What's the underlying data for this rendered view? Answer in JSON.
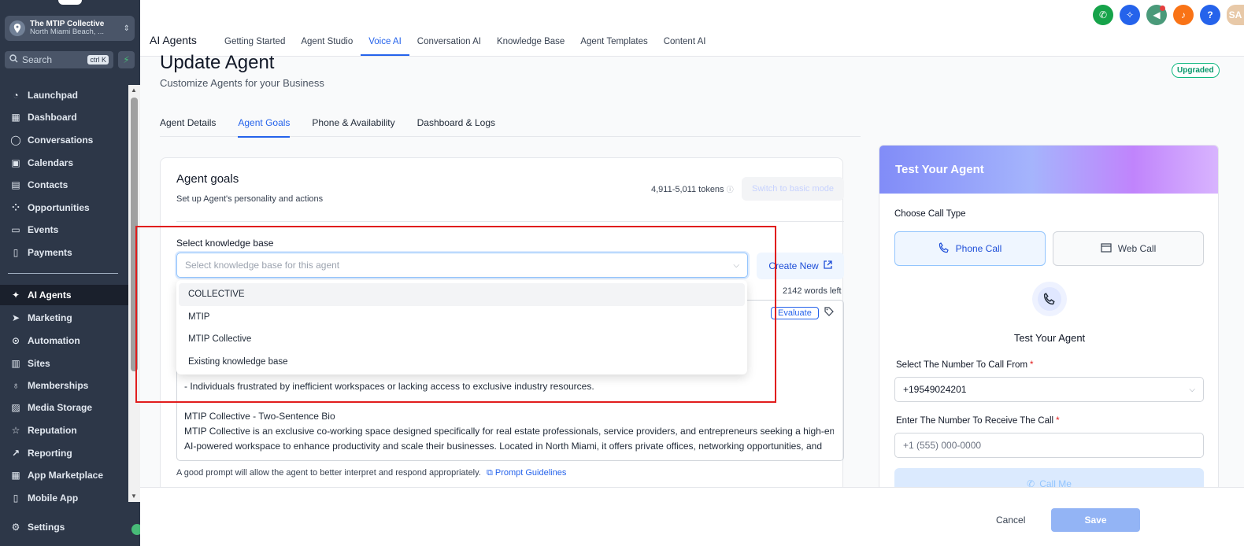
{
  "sidebar": {
    "account_name": "The MTIP Collective",
    "account_location": "North Miami Beach, ...",
    "search_placeholder": "Search",
    "search_shortcut": "ctrl K",
    "items": [
      {
        "label": "Launchpad",
        "icon": "rocket-icon"
      },
      {
        "label": "Dashboard",
        "icon": "grid-icon"
      },
      {
        "label": "Conversations",
        "icon": "chat-icon"
      },
      {
        "label": "Calendars",
        "icon": "calendar-icon"
      },
      {
        "label": "Contacts",
        "icon": "contacts-icon"
      },
      {
        "label": "Opportunities",
        "icon": "funnel-icon"
      },
      {
        "label": "Events",
        "icon": "event-icon"
      },
      {
        "label": "Payments",
        "icon": "receipt-icon"
      },
      {
        "label": "AI Agents",
        "icon": "sparkle-icon"
      },
      {
        "label": "Marketing",
        "icon": "send-icon"
      },
      {
        "label": "Automation",
        "icon": "automation-icon"
      },
      {
        "label": "Sites",
        "icon": "sites-icon"
      },
      {
        "label": "Memberships",
        "icon": "membership-icon"
      },
      {
        "label": "Media Storage",
        "icon": "image-icon"
      },
      {
        "label": "Reputation",
        "icon": "star-icon"
      },
      {
        "label": "Reporting",
        "icon": "trend-icon"
      },
      {
        "label": "App Marketplace",
        "icon": "apps-icon"
      },
      {
        "label": "Mobile App",
        "icon": "mobile-icon"
      }
    ],
    "settings_label": "Settings"
  },
  "topbar": {
    "app_title": "AI Agents",
    "tabs": [
      "Getting Started",
      "Agent Studio",
      "Voice AI",
      "Conversation AI",
      "Knowledge Base",
      "Agent Templates",
      "Content AI"
    ],
    "avatar_initials": "SA",
    "colors": {
      "phone": "#16a34a",
      "magic": "#2563eb",
      "announce": "#4a9a7a",
      "bell": "#f97316",
      "help": "#2563eb",
      "avatar": "#e8c9a8"
    }
  },
  "page": {
    "title": "Update Agent",
    "subtitle": "Customize Agents for your Business",
    "badge": "Upgraded",
    "subtabs": [
      "Agent Details",
      "Agent Goals",
      "Phone & Availability",
      "Dashboard & Logs"
    ]
  },
  "goals": {
    "title": "Agent goals",
    "subtitle": "Set up Agent's personality and actions",
    "tokens": "4,911-5,011 tokens",
    "basic_mode": "Switch to basic mode",
    "kb_label": "Select knowledge base",
    "kb_placeholder": "Select knowledge base for this agent",
    "create_new": "Create New",
    "words_left": "2142 words left",
    "evaluate": "Evaluate",
    "kb_options": [
      "COLLECTIVE",
      "MTIP",
      "MTIP Collective",
      "Existing knowledge base"
    ],
    "prompt_lines": [
      "- Individuals frustrated by inefficient workspaces or lacking access to exclusive industry resources.",
      "",
      "MTIP Collective - Two-Sentence Bio",
      "MTIP Collective is an exclusive co-working space designed specifically for real estate professionals, service providers, and entrepreneurs seeking a high-end,",
      "AI-powered workspace to enhance productivity and scale their businesses. Located in North Miami, it offers private offices, networking opportunities, and"
    ],
    "hint": "A good prompt will allow the agent to better interpret and respond appropriately.",
    "hint_link": "Prompt Guidelines"
  },
  "test_panel": {
    "header": "Test Your Agent",
    "call_type_label": "Choose Call Type",
    "phone_call": "Phone Call",
    "web_call": "Web Call",
    "title": "Test Your Agent",
    "from_label": "Select The Number To Call From",
    "from_value": "+19549024201",
    "to_label": "Enter The Number To Receive The Call",
    "to_placeholder": "+1 (555) 000-0000",
    "call_me": "Call Me",
    "required_mark": "*"
  },
  "footer": {
    "cancel": "Cancel",
    "save": "Save"
  }
}
